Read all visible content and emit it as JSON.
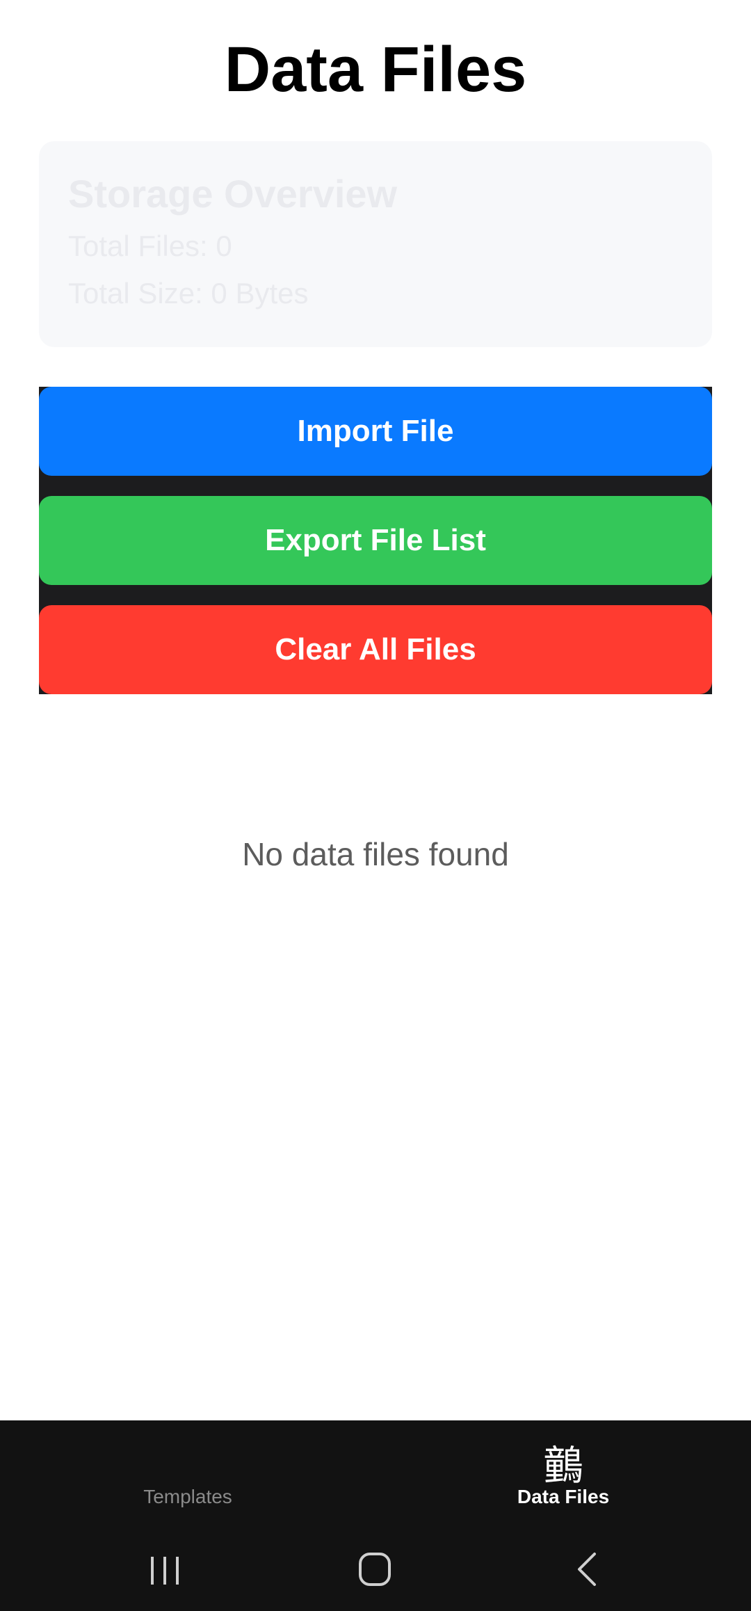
{
  "header": {
    "title": "Data Files"
  },
  "storage": {
    "title": "Storage Overview",
    "total_files": "Total Files: 0",
    "total_size": "Total Size: 0 Bytes"
  },
  "actions": {
    "import_label": "Import File",
    "export_label": "Export File List",
    "clear_label": "Clear All Files"
  },
  "empty_state": {
    "message": "No data files found"
  },
  "tabbar": {
    "templates_label": "Templates",
    "datafiles_label": "Data Files",
    "datafiles_icon_glyph": "䴀"
  },
  "system_nav": {
    "recents_icon": "recents-icon",
    "home_icon": "home-icon",
    "back_icon": "back-icon"
  },
  "colors": {
    "import": "#0a7aff",
    "export": "#34c759",
    "clear": "#ff3b30",
    "bar_bg": "#121212"
  }
}
